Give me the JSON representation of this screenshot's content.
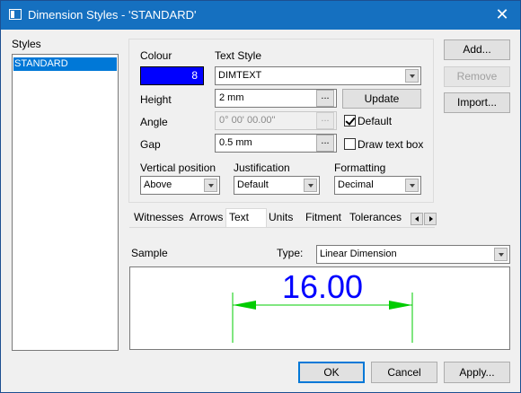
{
  "window": {
    "title": "Dimension Styles - 'STANDARD'"
  },
  "styles": {
    "label": "Styles",
    "items": [
      "STANDARD"
    ]
  },
  "text_style_panel": {
    "colour_label": "Colour",
    "colour_value": "8",
    "colour_hex": "#0000ff",
    "text_style_label": "Text Style",
    "text_style_value": "DIMTEXT",
    "height_label": "Height",
    "height_value": "2 mm",
    "update_label": "Update",
    "angle_label": "Angle",
    "angle_value": "0° 00' 00.00\"",
    "default_label": "Default",
    "default_checked": true,
    "gap_label": "Gap",
    "gap_value": "0.5 mm",
    "draw_text_box_label": "Draw text box",
    "draw_text_box_checked": false,
    "ellipsis": "...",
    "vertical_position_label": "Vertical position",
    "vertical_position_value": "Above",
    "justification_label": "Justification",
    "justification_value": "Default",
    "formatting_label": "Formatting",
    "formatting_value": "Decimal"
  },
  "side_buttons": {
    "add": "Add...",
    "remove": "Remove",
    "import": "Import..."
  },
  "tabs": [
    "Witnesses",
    "Arrows",
    "Text",
    "Units",
    "Fitment",
    "Tolerances"
  ],
  "active_tab": "Text",
  "sample": {
    "label": "Sample",
    "type_label": "Type:",
    "type_value": "Linear Dimension",
    "dimension_text": "16.00",
    "text_color": "#0000ff",
    "line_color": "#00cc00"
  },
  "footer": {
    "ok": "OK",
    "cancel": "Cancel",
    "apply": "Apply..."
  }
}
